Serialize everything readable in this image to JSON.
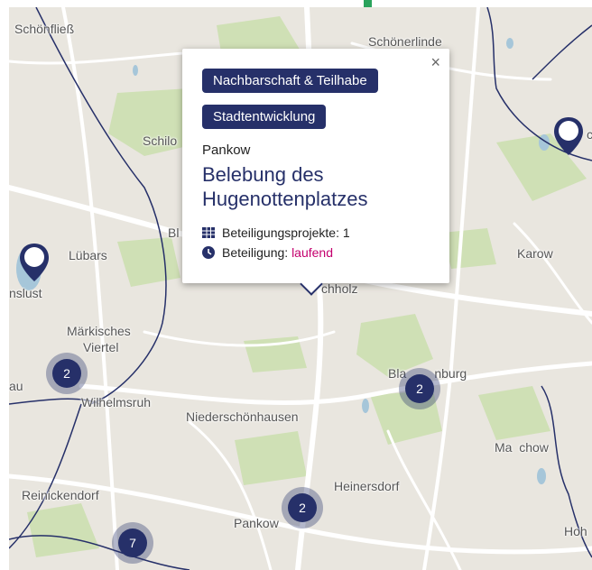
{
  "map": {
    "places": [
      {
        "id": "schoenfliess",
        "name": "Schönfließ"
      },
      {
        "id": "schoenerlinde",
        "name": "Schönerlinde"
      },
      {
        "id": "schildow",
        "name": "Schilo"
      },
      {
        "id": "luebars",
        "name": "Lübars"
      },
      {
        "id": "karow",
        "name": "Karow"
      },
      {
        "id": "nslust",
        "name": "nslust"
      },
      {
        "id": "maerkisches",
        "name": "Märkisches"
      },
      {
        "id": "viertel",
        "name": "Viertel"
      },
      {
        "id": "au",
        "name": "au"
      },
      {
        "id": "wilhelmsruh",
        "name": "Wilhelmsruh"
      },
      {
        "id": "niederschoenhausen",
        "name": "Niederschönhausen"
      },
      {
        "id": "blankenburg",
        "name": "Bla        nburg"
      },
      {
        "id": "malchow",
        "name": "Ma  chow"
      },
      {
        "id": "heinersdorf",
        "name": "Heinersdorf"
      },
      {
        "id": "reinickendorf",
        "name": "Reinickendorf"
      },
      {
        "id": "pankow",
        "name": "Pankow"
      },
      {
        "id": "hoh",
        "name": "Hoh"
      },
      {
        "id": "buchholz",
        "name": "chholz"
      },
      {
        "id": "bl",
        "name": "Bl"
      },
      {
        "id": "edge_c",
        "name": "c"
      }
    ],
    "clusters": [
      {
        "id": "cluster-wilhelmsruh",
        "count": "2"
      },
      {
        "id": "cluster-blankenburg",
        "count": "2"
      },
      {
        "id": "cluster-pankow",
        "count": "2"
      },
      {
        "id": "cluster-reinickendorf",
        "count": "7"
      }
    ],
    "colors": {
      "brand": "#263069",
      "status": "#c4006e",
      "water": "#a6c6d9",
      "park": "#cfe0b5",
      "road": "#ffffff",
      "boundary": "#263069",
      "background": "#e9e6df"
    }
  },
  "popup": {
    "close_label": "×",
    "tags": [
      "Nachbarschaft & Teilhabe",
      "Stadtentwicklung"
    ],
    "district": "Pankow",
    "title": "Belebung des Hugenottenplatzes",
    "projects_label": "Beteiligungsprojekte: 1",
    "participation_label": "Beteiligung:",
    "participation_status": "laufend",
    "icons": [
      "table-grid-icon",
      "clock-icon"
    ]
  }
}
